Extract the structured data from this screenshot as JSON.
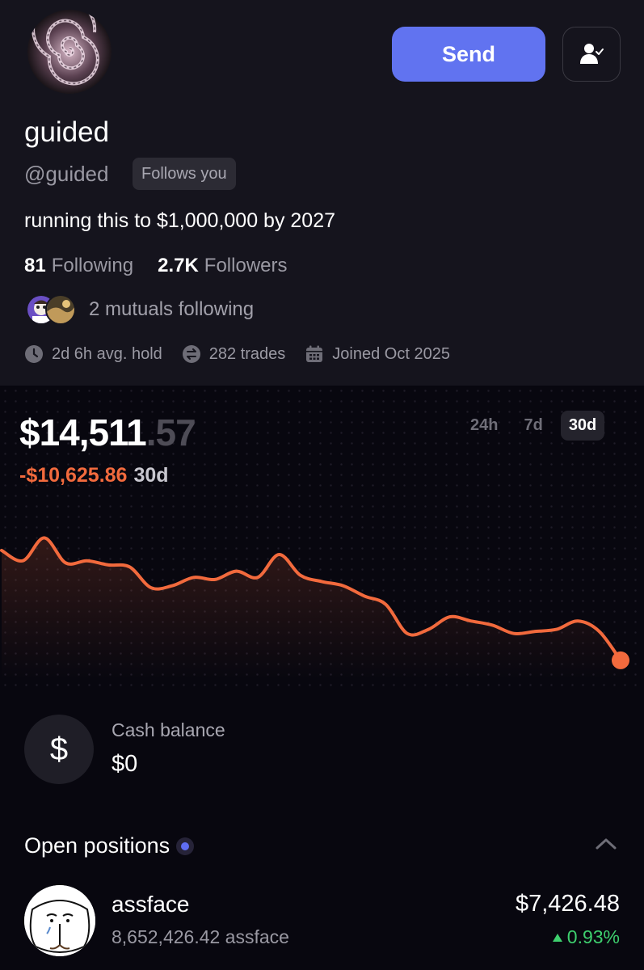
{
  "profile": {
    "display_name": "guided",
    "handle": "@guided",
    "follows_badge": "Follows you",
    "bio": "running this to $1,000,000 by 2027",
    "send_label": "Send",
    "following_count": "81",
    "following_label": "Following",
    "followers_count": "2.7K",
    "followers_label": "Followers",
    "mutuals_text": "2 mutuals following",
    "avg_hold": "2d 6h avg. hold",
    "trades": "282 trades",
    "joined": "Joined Oct 2025"
  },
  "portfolio": {
    "balance_main": "$14,511",
    "balance_cents": ".57",
    "change_value": "-$10,625.86",
    "change_period": "30d",
    "tabs": [
      {
        "label": "24h",
        "active": false
      },
      {
        "label": "7d",
        "active": false
      },
      {
        "label": "30d",
        "active": true
      }
    ]
  },
  "chart_data": {
    "type": "line",
    "title": "",
    "xlabel": "",
    "ylabel": "",
    "period": "30d",
    "line_color": "#f26a3d",
    "values": [
      19800,
      19300,
      20400,
      19200,
      19300,
      19100,
      19000,
      18000,
      18100,
      18500,
      18400,
      18800,
      18500,
      19600,
      18600,
      18300,
      18100,
      17600,
      17200,
      15800,
      16000,
      16600,
      16400,
      16200,
      15800,
      15900,
      16000,
      16400,
      15900,
      14511
    ],
    "ylim": [
      14000,
      21000
    ]
  },
  "cash": {
    "symbol": "$",
    "label": "Cash balance",
    "value": "$0"
  },
  "positions": {
    "title": "Open positions",
    "items": [
      {
        "name": "assface",
        "quantity": "8,652,426.42 assface",
        "value": "$7,426.48",
        "change": "0.93%",
        "change_color": "#3ecf6e"
      }
    ]
  },
  "colors": {
    "accent": "#6173f0",
    "negative": "#f26a3d",
    "positive": "#3ecf6e"
  }
}
